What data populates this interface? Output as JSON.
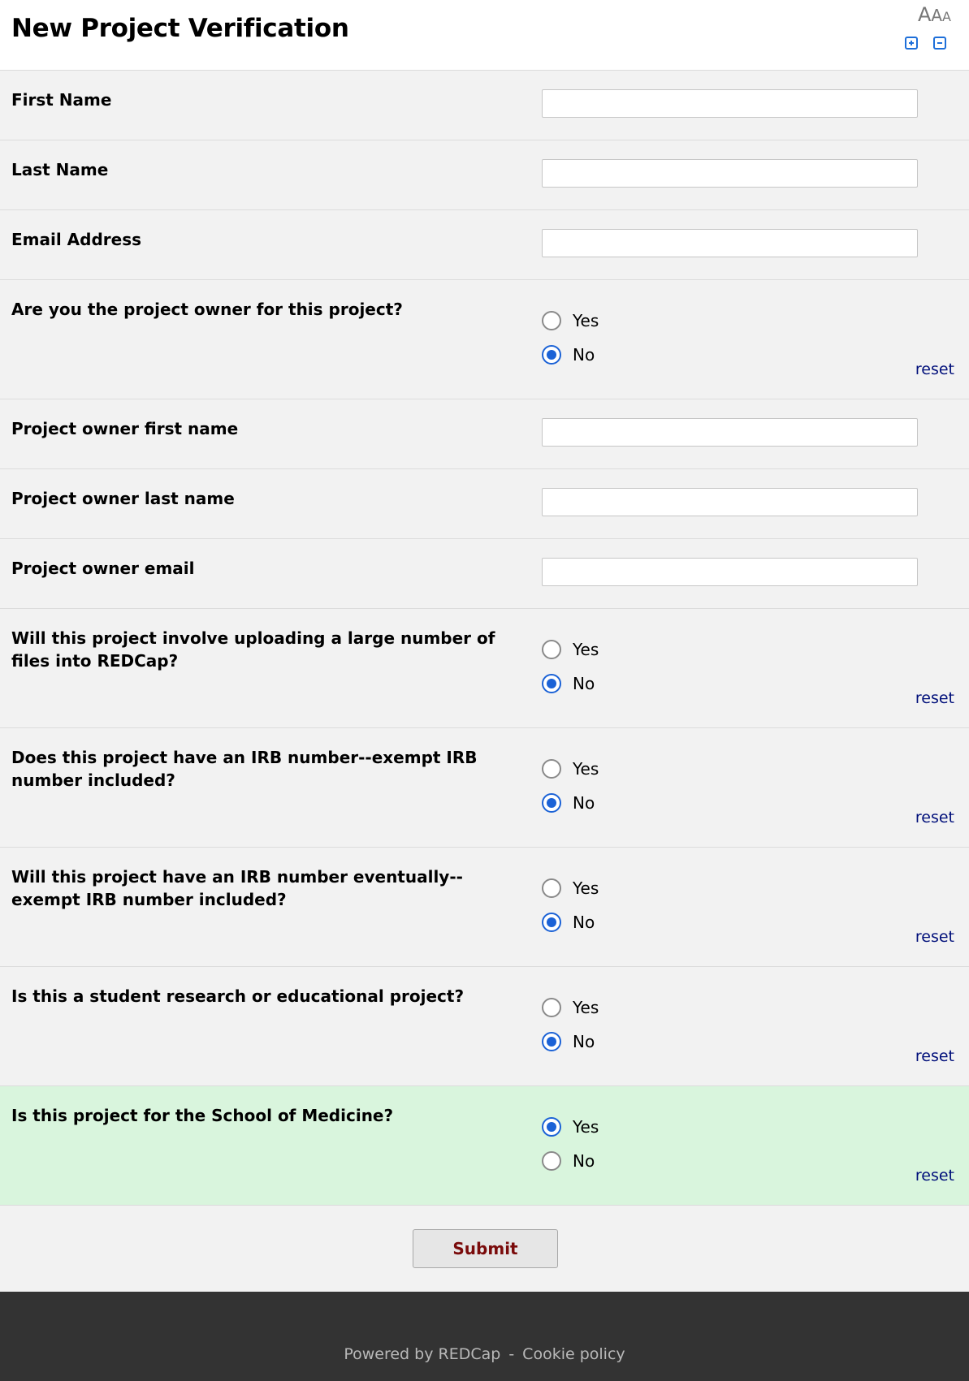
{
  "header": {
    "title": "New Project Verification",
    "font_size_glyphs": [
      "A",
      "A",
      "A"
    ],
    "increase_icon": "plus-square-icon",
    "decrease_icon": "minus-square-icon"
  },
  "text_fields": [
    {
      "label": "First Name",
      "value": ""
    },
    {
      "label": "Last Name",
      "value": ""
    },
    {
      "label": "Email Address",
      "value": ""
    }
  ],
  "q_owner": {
    "label": "Are you the project owner for this project?",
    "yes": "Yes",
    "no": "No",
    "selected": "No",
    "reset": "reset"
  },
  "owner_fields": [
    {
      "label": "Project owner first name",
      "value": ""
    },
    {
      "label": "Project owner last name",
      "value": ""
    },
    {
      "label": "Project owner email",
      "value": ""
    }
  ],
  "q_upload": {
    "label": "Will this project involve uploading a large number of files into REDCap?",
    "yes": "Yes",
    "no": "No",
    "selected": "No",
    "reset": "reset"
  },
  "q_irb": {
    "label": "Does this project have an IRB number--exempt IRB number included?",
    "yes": "Yes",
    "no": "No",
    "selected": "No",
    "reset": "reset"
  },
  "q_irb_eventually": {
    "label": "Will this project have an IRB number eventually--exempt IRB number included?",
    "yes": "Yes",
    "no": "No",
    "selected": "No",
    "reset": "reset"
  },
  "q_student": {
    "label": "Is this a student research or educational project?",
    "yes": "Yes",
    "no": "No",
    "selected": "No",
    "reset": "reset"
  },
  "q_som": {
    "label": "Is this project for the School of Medicine?",
    "yes": "Yes",
    "no": "No",
    "selected": "Yes",
    "reset": "reset"
  },
  "submit_label": "Submit",
  "footer": {
    "powered": "Powered by REDCap",
    "separator": "-",
    "cookie": "Cookie policy"
  },
  "colors": {
    "accent": "#1b62d6",
    "highlight_row": "#d9f5dd",
    "submit_text": "#7a0b0b",
    "footer_bg": "#333333"
  }
}
